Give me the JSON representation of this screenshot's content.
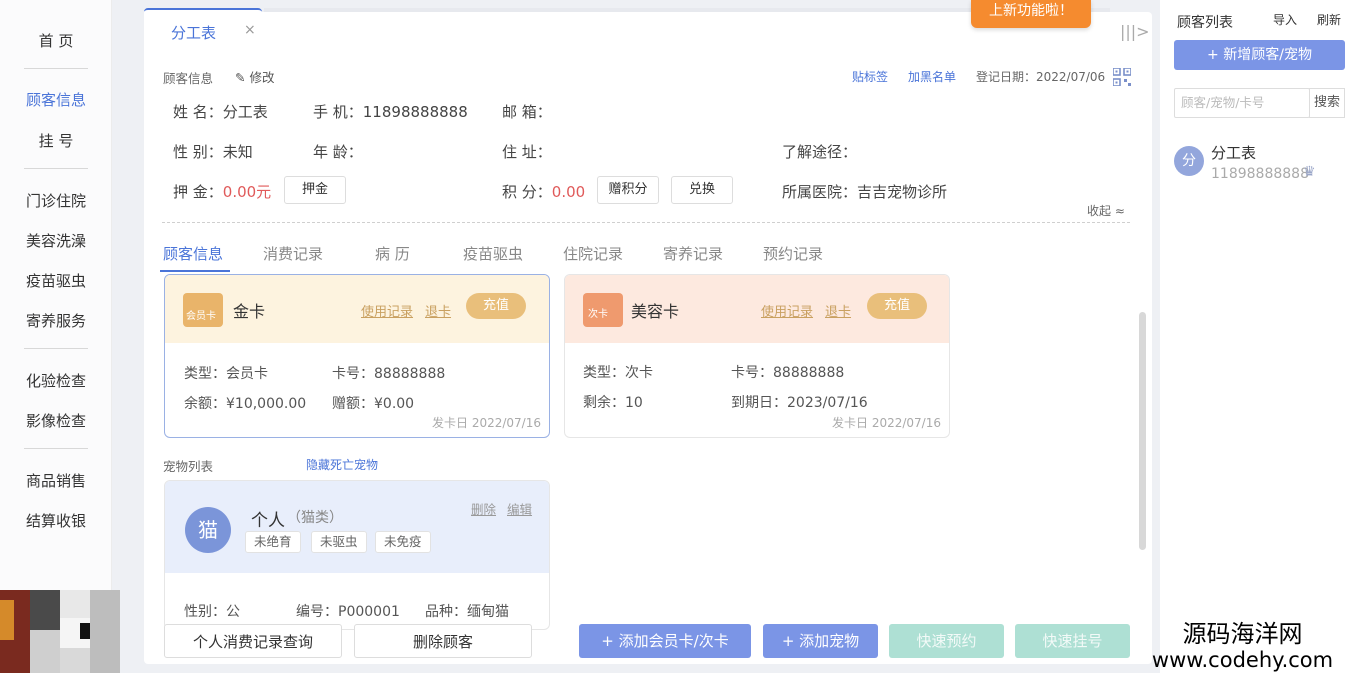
{
  "nav": {
    "home": "首 页",
    "customer_info": "顾客信息",
    "register": "挂 号",
    "clinic": "门诊住院",
    "grooming": "美容洗澡",
    "vaccine": "疫苗驱虫",
    "boarding": "寄养服务",
    "lab": "化验检查",
    "imaging": "影像检查",
    "sales": "商品销售",
    "checkout": "结算收银"
  },
  "tab": {
    "label": "分工表",
    "close": "×"
  },
  "promo": "上新功能啦！",
  "collapse_icon": "|||>",
  "header": {
    "section_title": "顾客信息",
    "edit_label": "修改",
    "sticker": "贴标签",
    "blacklist": "加黑名单",
    "reg_date": "登记日期：2022/07/06"
  },
  "customer": {
    "name": "姓 名：分工表",
    "phone": "手 机：11898888888",
    "email": "邮 箱：",
    "gender": "性 别：未知",
    "age": "年 龄：",
    "address": "住 址：",
    "source": "了解途径：",
    "deposit_label": "押 金：",
    "deposit_value": "0.00元",
    "deposit_btn": "押金",
    "points_label": "积 分：",
    "points_value": "0.00",
    "gift_points_btn": "赠积分",
    "redeem_btn": "兑换",
    "hospital": "所属医院：吉吉宠物诊所",
    "collapse": "收起 ≈"
  },
  "subtabs": [
    "顾客信息",
    "消费记录",
    "病 历",
    "疫苗驱虫",
    "住院记录",
    "寄养记录",
    "预约记录"
  ],
  "cards": {
    "gold": {
      "icon_text": "会员卡",
      "name": "金卡",
      "usage": "使用记录",
      "refund": "退卡",
      "charge": "充值",
      "type": "类型：会员卡",
      "number": "卡号：88888888",
      "balance": "余额：¥10,000.00",
      "gift": "赠额：¥0.00",
      "issue_date": "发卡日 2022/07/16"
    },
    "beauty": {
      "icon_text": "次卡",
      "name": "美容卡",
      "usage": "使用记录",
      "refund": "退卡",
      "charge": "充值",
      "type": "类型：次卡",
      "number": "卡号：88888888",
      "remaining": "剩余：10",
      "expiry": "到期日：2023/07/16",
      "issue_date": "发卡日 2022/07/16"
    }
  },
  "pets": {
    "title": "宠物列表",
    "hide_dead": "隐藏死亡宠物",
    "pet": {
      "avatar": "猫",
      "name": "个人",
      "category": "（猫类）",
      "delete": "删除",
      "edit": "编辑",
      "tags": [
        "未绝育",
        "未驱虫",
        "未免疫"
      ],
      "gender": "性别：公",
      "number": "编号：P000001",
      "breed": "品种：缅甸猫"
    }
  },
  "buttons": {
    "personal_records": "个人消费记录查询",
    "delete_customer": "删除顾客",
    "add_card": "+ 添加会员卡/次卡",
    "add_pet": "+ 添加宠物",
    "quick_appointment": "快速预约",
    "quick_register": "快速挂号"
  },
  "right": {
    "title": "顾客列表",
    "import": "导入",
    "refresh": "刷新",
    "add": "+ 新增顾客/宠物",
    "search_placeholder": "顾客/宠物/卡号",
    "search_btn": "搜索",
    "customer_avatar": "分",
    "customer_name": "分工表",
    "customer_phone": "11898888888",
    "crown": "♛"
  },
  "watermark": {
    "line1": "源码海洋网",
    "line2": "www.codehy.com"
  },
  "colors": {
    "accent": "#4a74d8",
    "promo": "#f58b2f",
    "charge": "#e9bf7b",
    "primary_btn": "#7b95e6",
    "teal_btn": "#aee0d4"
  }
}
